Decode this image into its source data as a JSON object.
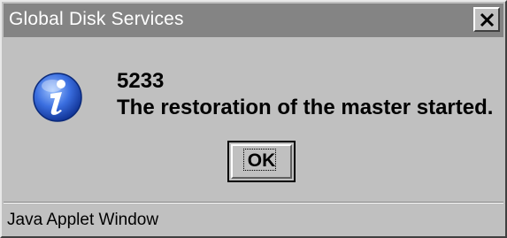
{
  "window": {
    "title": "Global Disk Services"
  },
  "dialog": {
    "icon": "information-icon",
    "message_code": "5233",
    "message_text": "The restoration of the master started.",
    "ok_label": "OK"
  },
  "status_bar": {
    "text": "Java Applet Window"
  },
  "colors": {
    "titlebar": "#848484",
    "face": "#c0c0c0",
    "icon_blue": "#1c4fc4"
  }
}
